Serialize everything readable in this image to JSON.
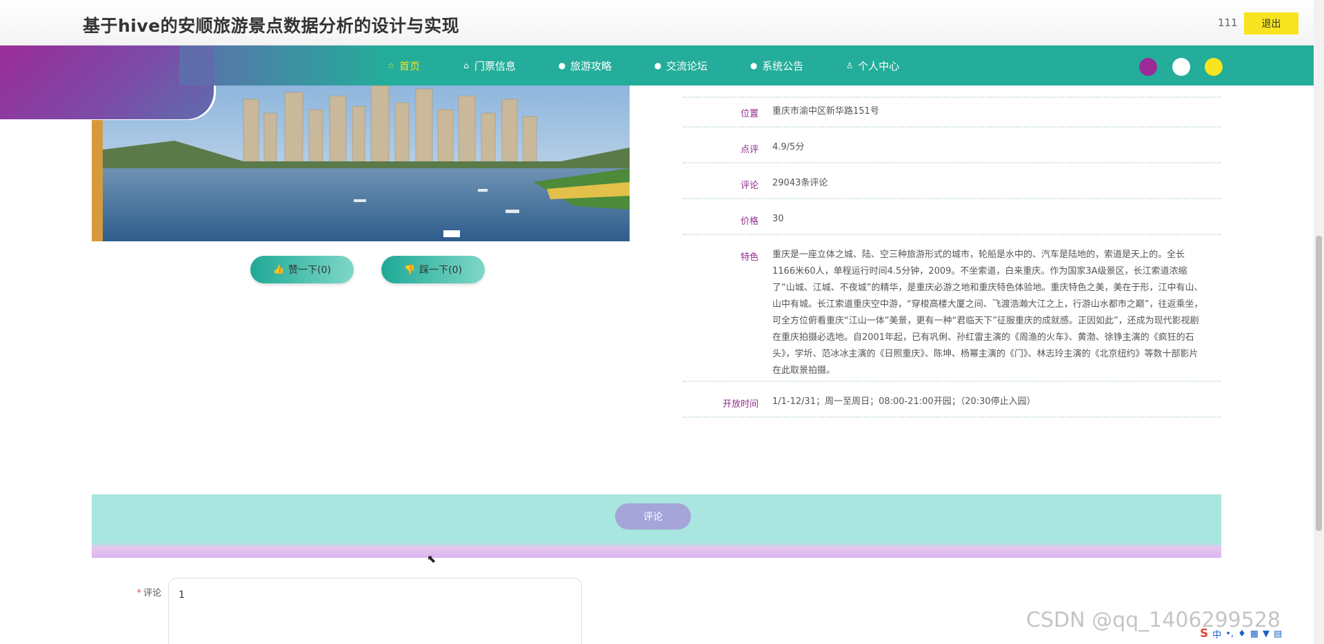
{
  "header": {
    "title": "基于hive的安顺旅游景点数据分析的设计与实现",
    "username": "111",
    "logout_label": "退出"
  },
  "nav": {
    "items": [
      {
        "label": "首页",
        "icon": "star-icon",
        "active": true
      },
      {
        "label": "门票信息",
        "icon": "home-icon",
        "active": false
      },
      {
        "label": "旅游攻略",
        "icon": "info-icon",
        "active": false
      },
      {
        "label": "交流论坛",
        "icon": "help-icon",
        "active": false
      },
      {
        "label": "系统公告",
        "icon": "info-icon",
        "active": false
      },
      {
        "label": "个人中心",
        "icon": "user-icon",
        "active": false
      }
    ],
    "theme_colors": [
      "#9b2c97",
      "#ffffff",
      "#f7e41f"
    ]
  },
  "actions": {
    "like_label": "赞一下(0)",
    "dislike_label": "踩一下(0)"
  },
  "details": [
    {
      "label": "位置",
      "value": "重庆市渝中区新华路151号"
    },
    {
      "label": "点评",
      "value": "4.9/5分"
    },
    {
      "label": "评论",
      "value": "29043条评论"
    },
    {
      "label": "价格",
      "value": "30"
    },
    {
      "label": "特色",
      "value": "重庆是一座立体之城、陆、空三种旅游形式的城市，轮船是水中的、汽车是陆地的，索道是天上的。全长1166米60人，单程运行时间4.5分钟，2009。不坐索道，白来重庆。作为国家3A级景区，长江索道浓缩了“山城、江城、不夜城”的精华，是重庆必游之地和重庆特色体验地。重庆特色之美，美在于形，江中有山、山中有城。长江索道重庆空中游，“穿梭高楼大厦之间、飞渡浩瀚大江之上，行游山水都市之巅”，往返乘坐，可全方位俯看重庆“江山一体”美景，更有一种“君临天下”征服重庆的成就感。正因如此”，还成为现代影视剧在重庆拍摄必选地。自2001年起，已有巩俐、孙红雷主演的《周渔的火车》、黄渤、徐铮主演的《疯狂的石头》，学圻、范冰冰主演的《日照重庆》、陈坤、杨幂主演的《门》、林志玲主演的《北京纽约》等数十部影片在此取景拍摄。"
    },
    {
      "label": "开放时间",
      "value": "1/1-12/31；周一至周日；08:00-21:00开园；（20:30停止入园）"
    }
  ],
  "comment": {
    "tab_label": "评论",
    "field_label": "评论",
    "required_mark": "*",
    "input_value": "1"
  },
  "watermark": "CSDN @qq_1406299528",
  "tray": {
    "logo": "S",
    "ime": "中"
  }
}
